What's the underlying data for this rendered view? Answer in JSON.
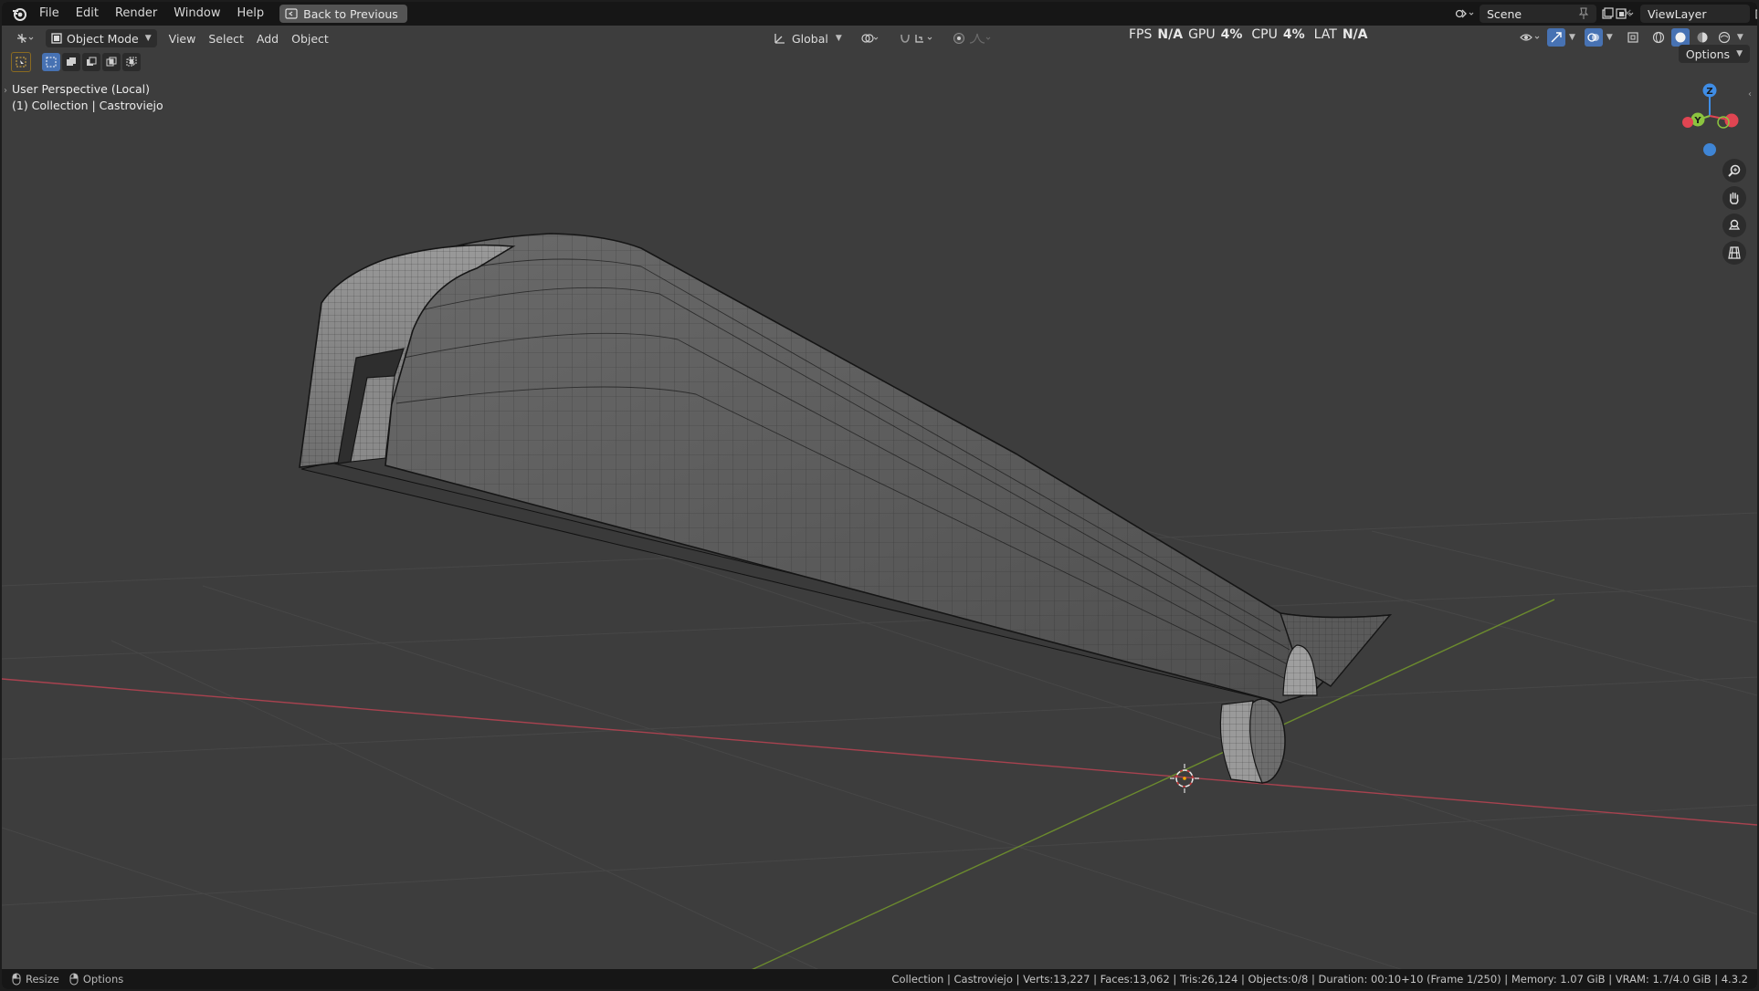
{
  "menu": {
    "items": [
      "File",
      "Edit",
      "Render",
      "Window",
      "Help"
    ],
    "back_button": "Back to Previous"
  },
  "scene": {
    "name": "Scene"
  },
  "view_layer": {
    "name": "ViewLayer"
  },
  "header": {
    "mode": "Object Mode",
    "menus": [
      "View",
      "Select",
      "Add",
      "Object"
    ],
    "transform_orientation": "Global",
    "options_label": "Options"
  },
  "perf": {
    "fps_label": "FPS",
    "fps_value": "N/A",
    "gpu_label": "GPU",
    "gpu_value": "4%",
    "cpu_label": "CPU",
    "cpu_value": "4%",
    "lat_label": "LAT",
    "lat_value": "N/A"
  },
  "viewport": {
    "perspective": "User Perspective (Local)",
    "collection": "(1) Collection | Castroviejo"
  },
  "gizmo": {
    "z": "Z",
    "y": "Y"
  },
  "statusbar": {
    "left_1": "Resize",
    "left_2": "Options",
    "info": "Collection | Castroviejo | Verts:13,227 | Faces:13,062 | Tris:26,124 | Objects:0/8 | Duration: 00:10+10 (Frame 1/250) | Memory: 1.07 GiB | VRAM: 1.7/4.0 GiB | 4.3.2"
  },
  "colors": {
    "viewport_bg": "#3d3d3d",
    "topbar_bg": "#161616",
    "x_axis": "#a8424f",
    "y_axis": "#6b8a2e",
    "gizmo_x": "#e04552",
    "gizmo_y": "#8bc43f",
    "gizmo_z": "#3f8de6",
    "accent": "#4772b3"
  },
  "icons": [
    "blender-logo-icon",
    "back-icon",
    "scene-icon",
    "pin-icon",
    "new-icon",
    "close-icon",
    "view-layer-icon",
    "editor-type-icon",
    "object-mode-icon",
    "transform-icon",
    "pivot-icon",
    "snap-icon",
    "proportional-icon",
    "select-box-icon",
    "zoom-icon",
    "hand-icon",
    "camera-icon",
    "grid-icon",
    "mouse-icon"
  ]
}
